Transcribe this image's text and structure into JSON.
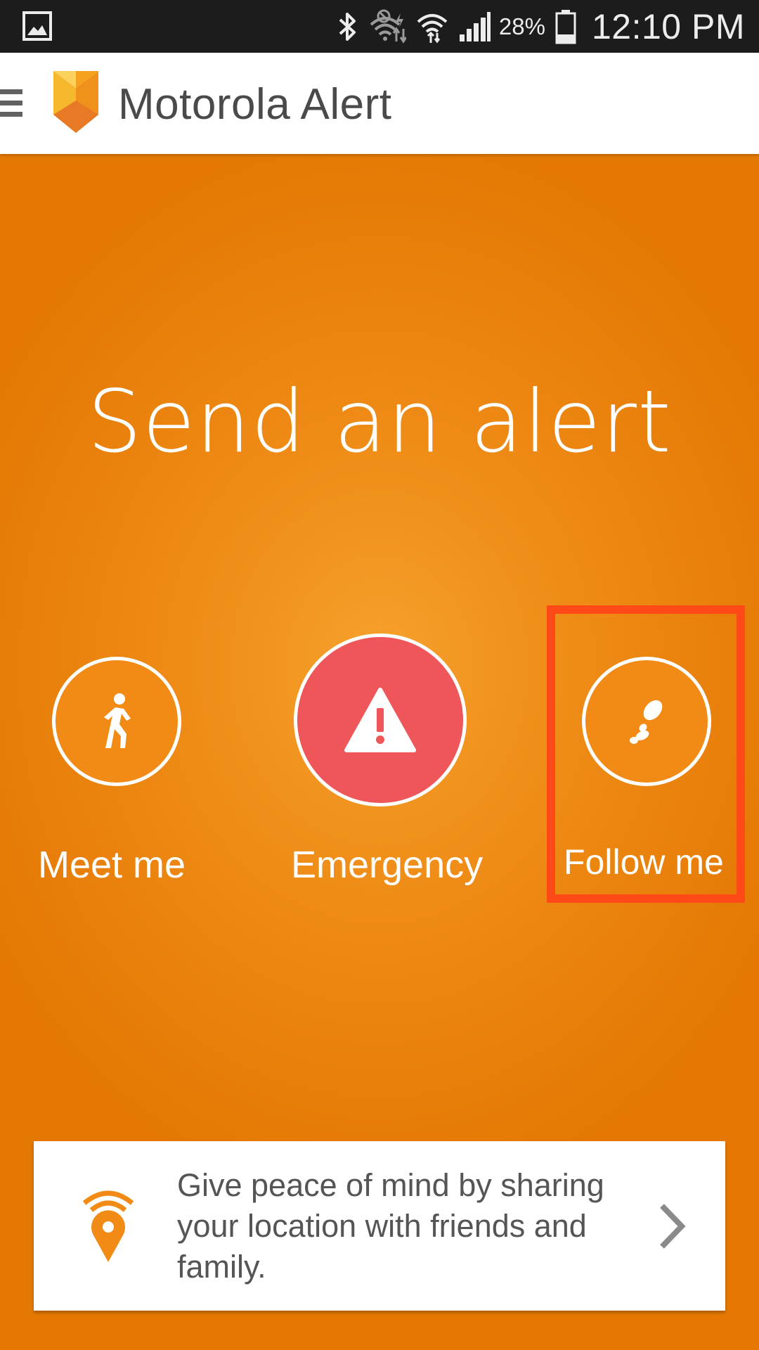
{
  "status_bar": {
    "battery_percent": "28%",
    "time": "12:10 PM",
    "icons": [
      "gallery-icon",
      "bluetooth-icon",
      "wifi-off-icon",
      "wifi-icon",
      "signal-icon",
      "battery-icon"
    ]
  },
  "app_bar": {
    "title": "Motorola Alert",
    "menu_icon": "hamburger-menu-icon",
    "logo": "motorola-alert-logo"
  },
  "main": {
    "headline": "Send an alert",
    "background_color": "#ee8b16",
    "actions": [
      {
        "label": "Meet me",
        "icon": "walking-person-icon"
      },
      {
        "label": "Emergency",
        "icon": "warning-triangle-icon",
        "color": "#ef5659"
      },
      {
        "label": "Follow me",
        "icon": "footprints-icon",
        "highlighted": true
      }
    ]
  },
  "info_card": {
    "text": "Give peace of mind by sharing your location with friends and family.",
    "icon": "location-broadcast-icon",
    "chevron": "chevron-right-icon"
  },
  "colors": {
    "accent_orange": "#f28b16",
    "emergency_red": "#ef5659",
    "highlight_red": "#ff4a17"
  }
}
